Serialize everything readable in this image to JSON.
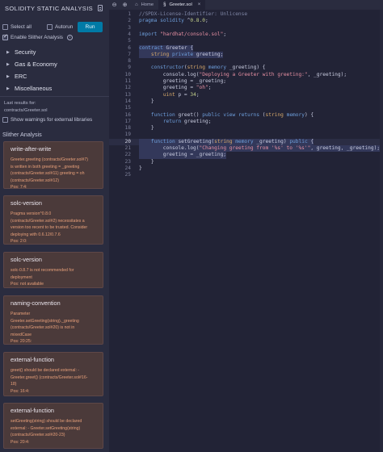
{
  "panel": {
    "title": "SOLIDITY STATIC ANALYSIS",
    "select_all_label": "Select all",
    "autorun_label": "Autorun",
    "run_label": "Run",
    "enable_slither_label": "Enable Slither Analysis",
    "menu": [
      {
        "label": "Security"
      },
      {
        "label": "Gas & Economy"
      },
      {
        "label": "ERC"
      },
      {
        "label": "Miscellaneous"
      }
    ],
    "last_results_label": "Last results for:",
    "last_results_file": "contracts/Greeter.sol",
    "show_warnings_label": "Show warnings for external libraries",
    "slither_title": "Slither Analysis",
    "cards": [
      {
        "title": "write-after-write",
        "lines": [
          "Greeter.greeting (contracts/Greeter.sol#7)",
          "is written in both greeting = _greeting",
          "(contracts/Greeter.sol#11) greeting = oh",
          "(contracts/Greeter.sol#12)",
          "Pos: 7:4:"
        ]
      },
      {
        "title": "solc-version",
        "lines": [
          "Pragma version^0.8.0",
          "(contracts/Greeter.sol#2) necessitates a",
          "version too recent to be trusted. Consider",
          "deploying with 0.6.12/0.7.6",
          "Pos: 2:0:"
        ]
      },
      {
        "title": "solc-version",
        "lines": [
          "solc-0.8.7 is not recommended for",
          "deployment",
          "Pos: not available"
        ]
      },
      {
        "title": "naming-convention",
        "lines": [
          "Parameter",
          "Greeter.setGreeting(string)._greeting",
          "(contracts/Greeter.sol#20) is not in",
          "mixedCase",
          "Pos: 20:25:"
        ]
      },
      {
        "title": "external-function",
        "lines": [
          "greet() should be declared external: -",
          "Greeter.greet() (contracts/Greeter.sol#16-",
          "18)",
          "Pos: 16:4:"
        ]
      },
      {
        "title": "external-function",
        "lines": [
          "setGreeting(string) should be declared",
          "external: - Greeter.setGreeting(string)",
          "(contracts/Greeter.sol#20-23)",
          "Pos: 20:4:"
        ]
      }
    ]
  },
  "editor": {
    "home_tab": "Home",
    "file_tab": "Greeter.sol",
    "current_line": 20,
    "lines": [
      "//SPDX-License-Identifier: Unlicense",
      "pragma solidity ^0.8.0;",
      "",
      "import \"hardhat/console.sol\";",
      "",
      "contract Greeter {",
      "    string private greeting;",
      "",
      "    constructor(string memory _greeting) {",
      "        console.log(\"Deploying a Greeter with greeting:\", _greeting);",
      "        greeting = _greeting;",
      "        greeting = \"oh\";",
      "        uint p = 34;",
      "    }",
      "",
      "    function greet() public view returns (string memory) {",
      "        return greeting;",
      "    }",
      "",
      "    function setGreeting(string memory _greeting) public {",
      "        console.log(\"Changing greeting from '%s' to '%s'\", greeting, _greeting);",
      "        greeting = _greeting;",
      "    }",
      "}",
      ""
    ],
    "highlighted_lines": [
      6,
      7,
      20,
      21,
      22
    ]
  }
}
